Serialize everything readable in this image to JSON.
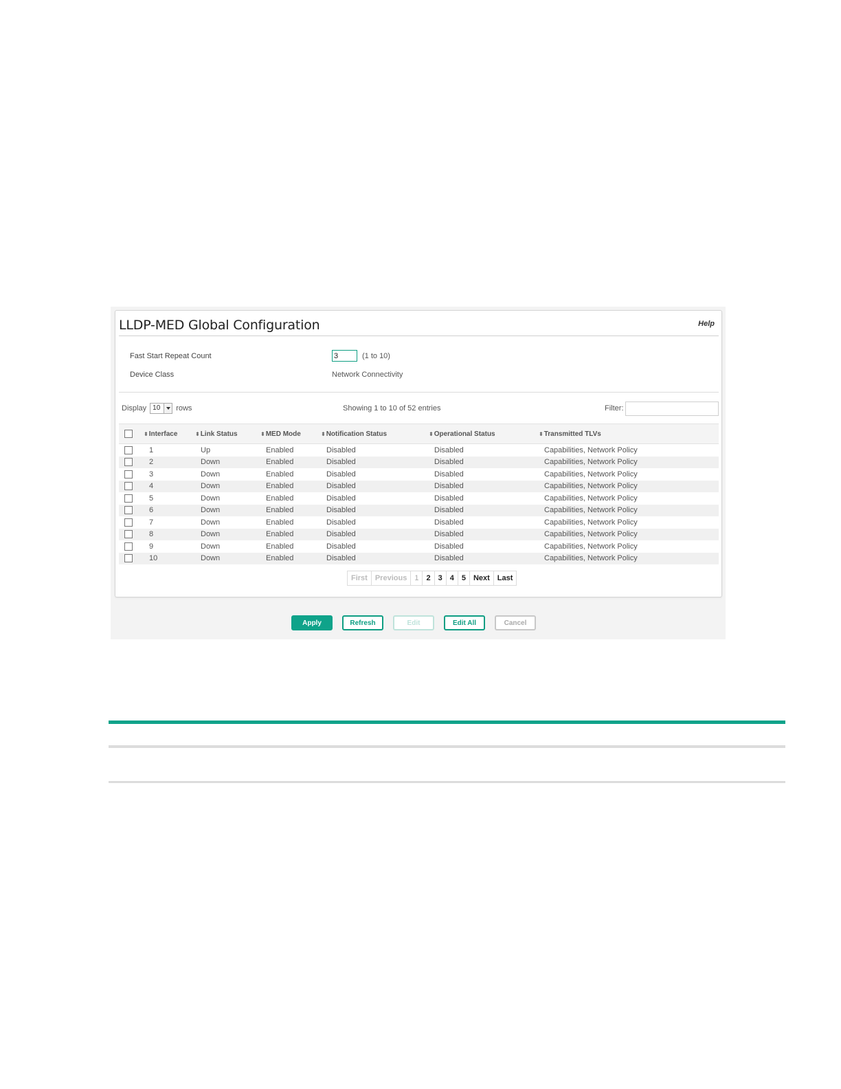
{
  "window": {
    "title": "LLDP-MED Global Configuration",
    "help_label": "Help"
  },
  "form": {
    "fast_start_label": "Fast Start Repeat Count",
    "fast_start_value": "3",
    "fast_start_range": "(1 to 10)",
    "device_class_label": "Device Class",
    "device_class_value": "Network Connectivity"
  },
  "table_controls": {
    "display_label": "Display",
    "rows_value": "10",
    "rows_label": "rows",
    "showing_text": "Showing 1 to 10 of 52 entries",
    "filter_label": "Filter:",
    "filter_value": ""
  },
  "table": {
    "columns": [
      "Interface",
      "Link Status",
      "MED Mode",
      "Notification Status",
      "Operational Status",
      "Transmitted TLVs"
    ],
    "rows": [
      [
        "1",
        "Up",
        "Enabled",
        "Disabled",
        "Disabled",
        "Capabilities, Network Policy"
      ],
      [
        "2",
        "Down",
        "Enabled",
        "Disabled",
        "Disabled",
        "Capabilities, Network Policy"
      ],
      [
        "3",
        "Down",
        "Enabled",
        "Disabled",
        "Disabled",
        "Capabilities, Network Policy"
      ],
      [
        "4",
        "Down",
        "Enabled",
        "Disabled",
        "Disabled",
        "Capabilities, Network Policy"
      ],
      [
        "5",
        "Down",
        "Enabled",
        "Disabled",
        "Disabled",
        "Capabilities, Network Policy"
      ],
      [
        "6",
        "Down",
        "Enabled",
        "Disabled",
        "Disabled",
        "Capabilities, Network Policy"
      ],
      [
        "7",
        "Down",
        "Enabled",
        "Disabled",
        "Disabled",
        "Capabilities, Network Policy"
      ],
      [
        "8",
        "Down",
        "Enabled",
        "Disabled",
        "Disabled",
        "Capabilities, Network Policy"
      ],
      [
        "9",
        "Down",
        "Enabled",
        "Disabled",
        "Disabled",
        "Capabilities, Network Policy"
      ],
      [
        "10",
        "Down",
        "Enabled",
        "Disabled",
        "Disabled",
        "Capabilities, Network Policy"
      ]
    ]
  },
  "pagination": {
    "first": "First",
    "previous": "Previous",
    "pages": [
      "1",
      "2",
      "3",
      "4",
      "5"
    ],
    "current_page": "1",
    "next": "Next",
    "last": "Last"
  },
  "buttons": {
    "apply": "Apply",
    "refresh": "Refresh",
    "edit": "Edit",
    "edit_all": "Edit All",
    "cancel": "Cancel"
  },
  "colors": {
    "accent": "#0fa38a",
    "zebra": "#f0f0f0"
  }
}
